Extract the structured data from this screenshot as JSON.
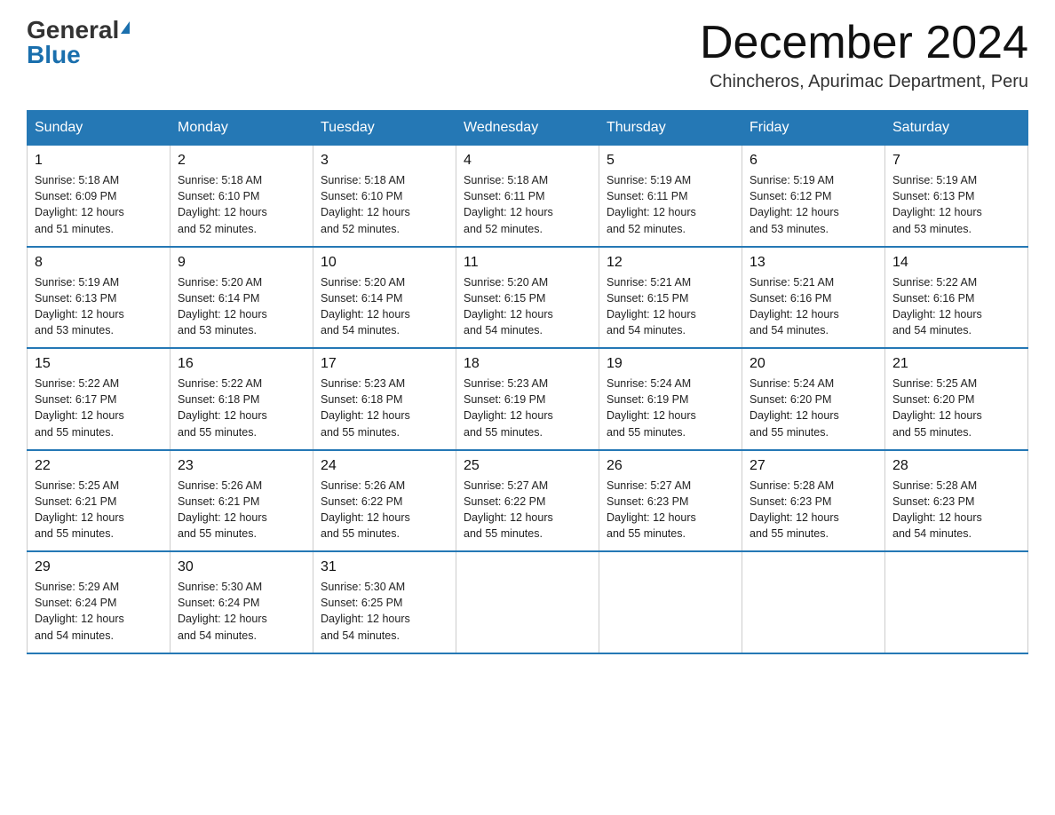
{
  "header": {
    "logo_general": "General",
    "logo_blue": "Blue",
    "month_title": "December 2024",
    "location": "Chincheros, Apurimac Department, Peru"
  },
  "days_of_week": [
    "Sunday",
    "Monday",
    "Tuesday",
    "Wednesday",
    "Thursday",
    "Friday",
    "Saturday"
  ],
  "weeks": [
    [
      {
        "day": "1",
        "sunrise": "5:18 AM",
        "sunset": "6:09 PM",
        "daylight": "12 hours and 51 minutes."
      },
      {
        "day": "2",
        "sunrise": "5:18 AM",
        "sunset": "6:10 PM",
        "daylight": "12 hours and 52 minutes."
      },
      {
        "day": "3",
        "sunrise": "5:18 AM",
        "sunset": "6:10 PM",
        "daylight": "12 hours and 52 minutes."
      },
      {
        "day": "4",
        "sunrise": "5:18 AM",
        "sunset": "6:11 PM",
        "daylight": "12 hours and 52 minutes."
      },
      {
        "day": "5",
        "sunrise": "5:19 AM",
        "sunset": "6:11 PM",
        "daylight": "12 hours and 52 minutes."
      },
      {
        "day": "6",
        "sunrise": "5:19 AM",
        "sunset": "6:12 PM",
        "daylight": "12 hours and 53 minutes."
      },
      {
        "day": "7",
        "sunrise": "5:19 AM",
        "sunset": "6:13 PM",
        "daylight": "12 hours and 53 minutes."
      }
    ],
    [
      {
        "day": "8",
        "sunrise": "5:19 AM",
        "sunset": "6:13 PM",
        "daylight": "12 hours and 53 minutes."
      },
      {
        "day": "9",
        "sunrise": "5:20 AM",
        "sunset": "6:14 PM",
        "daylight": "12 hours and 53 minutes."
      },
      {
        "day": "10",
        "sunrise": "5:20 AM",
        "sunset": "6:14 PM",
        "daylight": "12 hours and 54 minutes."
      },
      {
        "day": "11",
        "sunrise": "5:20 AM",
        "sunset": "6:15 PM",
        "daylight": "12 hours and 54 minutes."
      },
      {
        "day": "12",
        "sunrise": "5:21 AM",
        "sunset": "6:15 PM",
        "daylight": "12 hours and 54 minutes."
      },
      {
        "day": "13",
        "sunrise": "5:21 AM",
        "sunset": "6:16 PM",
        "daylight": "12 hours and 54 minutes."
      },
      {
        "day": "14",
        "sunrise": "5:22 AM",
        "sunset": "6:16 PM",
        "daylight": "12 hours and 54 minutes."
      }
    ],
    [
      {
        "day": "15",
        "sunrise": "5:22 AM",
        "sunset": "6:17 PM",
        "daylight": "12 hours and 55 minutes."
      },
      {
        "day": "16",
        "sunrise": "5:22 AM",
        "sunset": "6:18 PM",
        "daylight": "12 hours and 55 minutes."
      },
      {
        "day": "17",
        "sunrise": "5:23 AM",
        "sunset": "6:18 PM",
        "daylight": "12 hours and 55 minutes."
      },
      {
        "day": "18",
        "sunrise": "5:23 AM",
        "sunset": "6:19 PM",
        "daylight": "12 hours and 55 minutes."
      },
      {
        "day": "19",
        "sunrise": "5:24 AM",
        "sunset": "6:19 PM",
        "daylight": "12 hours and 55 minutes."
      },
      {
        "day": "20",
        "sunrise": "5:24 AM",
        "sunset": "6:20 PM",
        "daylight": "12 hours and 55 minutes."
      },
      {
        "day": "21",
        "sunrise": "5:25 AM",
        "sunset": "6:20 PM",
        "daylight": "12 hours and 55 minutes."
      }
    ],
    [
      {
        "day": "22",
        "sunrise": "5:25 AM",
        "sunset": "6:21 PM",
        "daylight": "12 hours and 55 minutes."
      },
      {
        "day": "23",
        "sunrise": "5:26 AM",
        "sunset": "6:21 PM",
        "daylight": "12 hours and 55 minutes."
      },
      {
        "day": "24",
        "sunrise": "5:26 AM",
        "sunset": "6:22 PM",
        "daylight": "12 hours and 55 minutes."
      },
      {
        "day": "25",
        "sunrise": "5:27 AM",
        "sunset": "6:22 PM",
        "daylight": "12 hours and 55 minutes."
      },
      {
        "day": "26",
        "sunrise": "5:27 AM",
        "sunset": "6:23 PM",
        "daylight": "12 hours and 55 minutes."
      },
      {
        "day": "27",
        "sunrise": "5:28 AM",
        "sunset": "6:23 PM",
        "daylight": "12 hours and 55 minutes."
      },
      {
        "day": "28",
        "sunrise": "5:28 AM",
        "sunset": "6:23 PM",
        "daylight": "12 hours and 54 minutes."
      }
    ],
    [
      {
        "day": "29",
        "sunrise": "5:29 AM",
        "sunset": "6:24 PM",
        "daylight": "12 hours and 54 minutes."
      },
      {
        "day": "30",
        "sunrise": "5:30 AM",
        "sunset": "6:24 PM",
        "daylight": "12 hours and 54 minutes."
      },
      {
        "day": "31",
        "sunrise": "5:30 AM",
        "sunset": "6:25 PM",
        "daylight": "12 hours and 54 minutes."
      },
      null,
      null,
      null,
      null
    ]
  ],
  "labels": {
    "sunrise": "Sunrise:",
    "sunset": "Sunset:",
    "daylight": "Daylight:"
  }
}
